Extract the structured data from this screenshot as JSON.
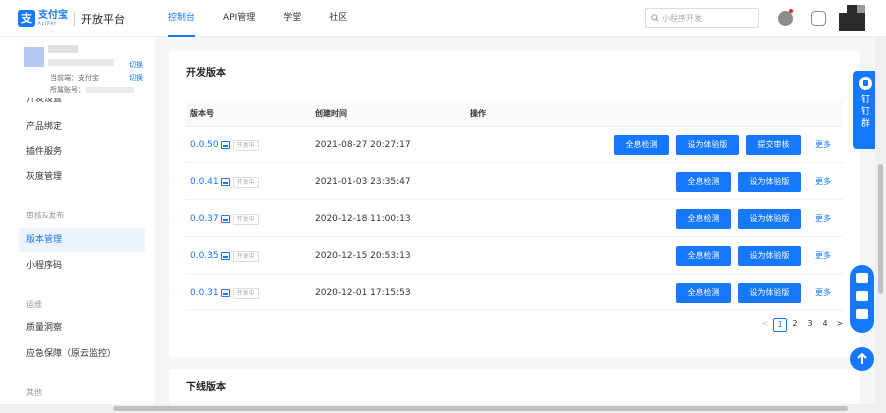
{
  "brand": {
    "mark": "支",
    "name_cn": "支付宝",
    "name_en": "ALIPAY",
    "platform": "开放平台"
  },
  "nav": [
    {
      "label": "控制台",
      "active": true
    },
    {
      "label": "API管理",
      "active": false
    },
    {
      "label": "学堂",
      "active": false
    },
    {
      "label": "社区",
      "active": false
    }
  ],
  "search": {
    "placeholder": "小程序开发"
  },
  "account": {
    "current_label": "当前端：支付宝",
    "belongs_label": "所属账号：",
    "switch_label": "切换"
  },
  "sidebar": {
    "partial_item": "开发设置",
    "items_top": [
      "产品绑定",
      "插件服务",
      "灰度管理"
    ],
    "group_review": "审核&发布",
    "items_review": [
      "版本管理",
      "小程序码"
    ],
    "group_ops": "运维",
    "items_ops": [
      "质量洞察",
      "应急保障（原云监控）"
    ],
    "group_other": "其他"
  },
  "dev_versions": {
    "title": "开发版本",
    "columns": [
      "版本号",
      "创建时间",
      "操作"
    ],
    "tag": "开发中",
    "actions": {
      "scan": "全息检测",
      "trial": "设为体验版",
      "submit": "提交审核",
      "more": "更多"
    },
    "rows": [
      {
        "version": "0.0.50",
        "created": "2021-08-27 20:27:17",
        "can_submit": true
      },
      {
        "version": "0.0.41",
        "created": "2021-01-03 23:35:47",
        "can_submit": false
      },
      {
        "version": "0.0.37",
        "created": "2020-12-18 11:00:13",
        "can_submit": false
      },
      {
        "version": "0.0.35",
        "created": "2020-12-15 20:53:13",
        "can_submit": false
      },
      {
        "version": "0.0.31",
        "created": "2020-12-01 17:15:53",
        "can_submit": false
      }
    ],
    "pagination": {
      "prev": "<",
      "pages": [
        "1",
        "2",
        "3",
        "4"
      ],
      "current": "1",
      "next": ">"
    }
  },
  "offline_versions": {
    "title": "下线版本"
  },
  "dingtalk": {
    "chars": [
      "钉",
      "钉",
      "群"
    ]
  },
  "colors": {
    "primary": "#1677ff",
    "active_bg": "#eef4ff"
  }
}
